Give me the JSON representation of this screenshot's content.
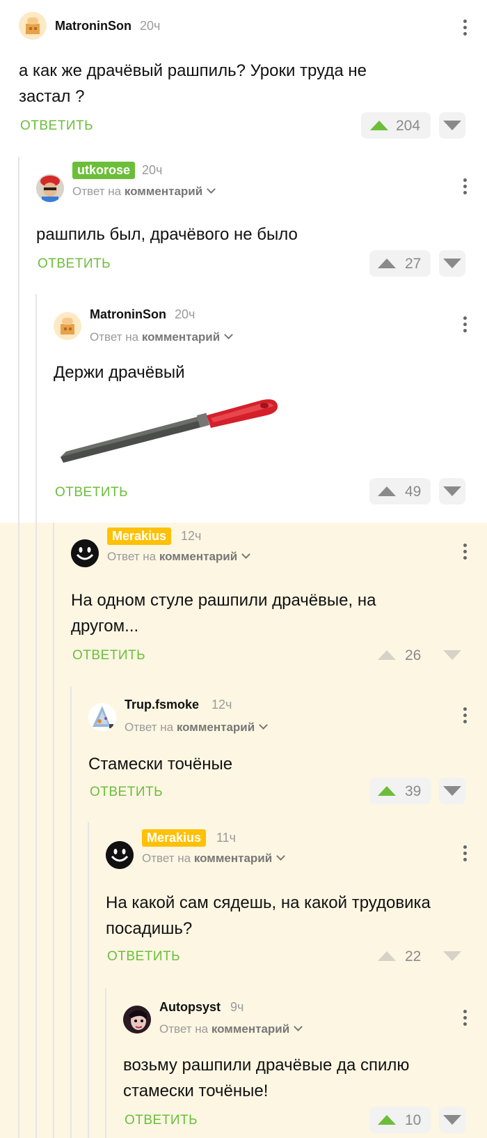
{
  "colors": {
    "accent_green": "#6cbe3a",
    "badge_green": "#6cbe3a",
    "badge_yellow": "#ffc107",
    "thread_bg_yellow": "#fcf6e3"
  },
  "common": {
    "reply_label": "ОТВЕТИТЬ",
    "reply_to_prefix": "Ответ на",
    "reply_to_target": "комментарий"
  },
  "comments": [
    {
      "author": "MatroninSon",
      "time": "20ч",
      "text": "а как же драчёвый рашпиль? Уроки труда не застал ?",
      "score": "204",
      "voted": "up"
    },
    {
      "author": "utkorose",
      "author_badge": "green",
      "time": "20ч",
      "text": "рашпиль был, драчёвого не было",
      "score": "27"
    },
    {
      "author": "MatroninSon",
      "time": "20ч",
      "text": "Держи драчёвый",
      "image": "file-tool-image",
      "score": "49"
    },
    {
      "author": "Merakius",
      "author_badge": "yellow",
      "time": "12ч",
      "text": "На одном стуле рашпили драчёвые, на другом...",
      "score": "26"
    },
    {
      "author": "Trup.fsmoke",
      "time": "12ч",
      "text": "Стамески точёные",
      "score": "39",
      "voted": "up"
    },
    {
      "author": "Merakius",
      "author_badge": "yellow",
      "time": "11ч",
      "text": "На какой сам сядешь, на какой трудовика посадишь?",
      "score": "22"
    },
    {
      "author": "Autopsyst",
      "time": "9ч",
      "text": "возьму рашпили драчёвые да спилю стамески точёные!",
      "score": "10",
      "voted": "up"
    }
  ]
}
